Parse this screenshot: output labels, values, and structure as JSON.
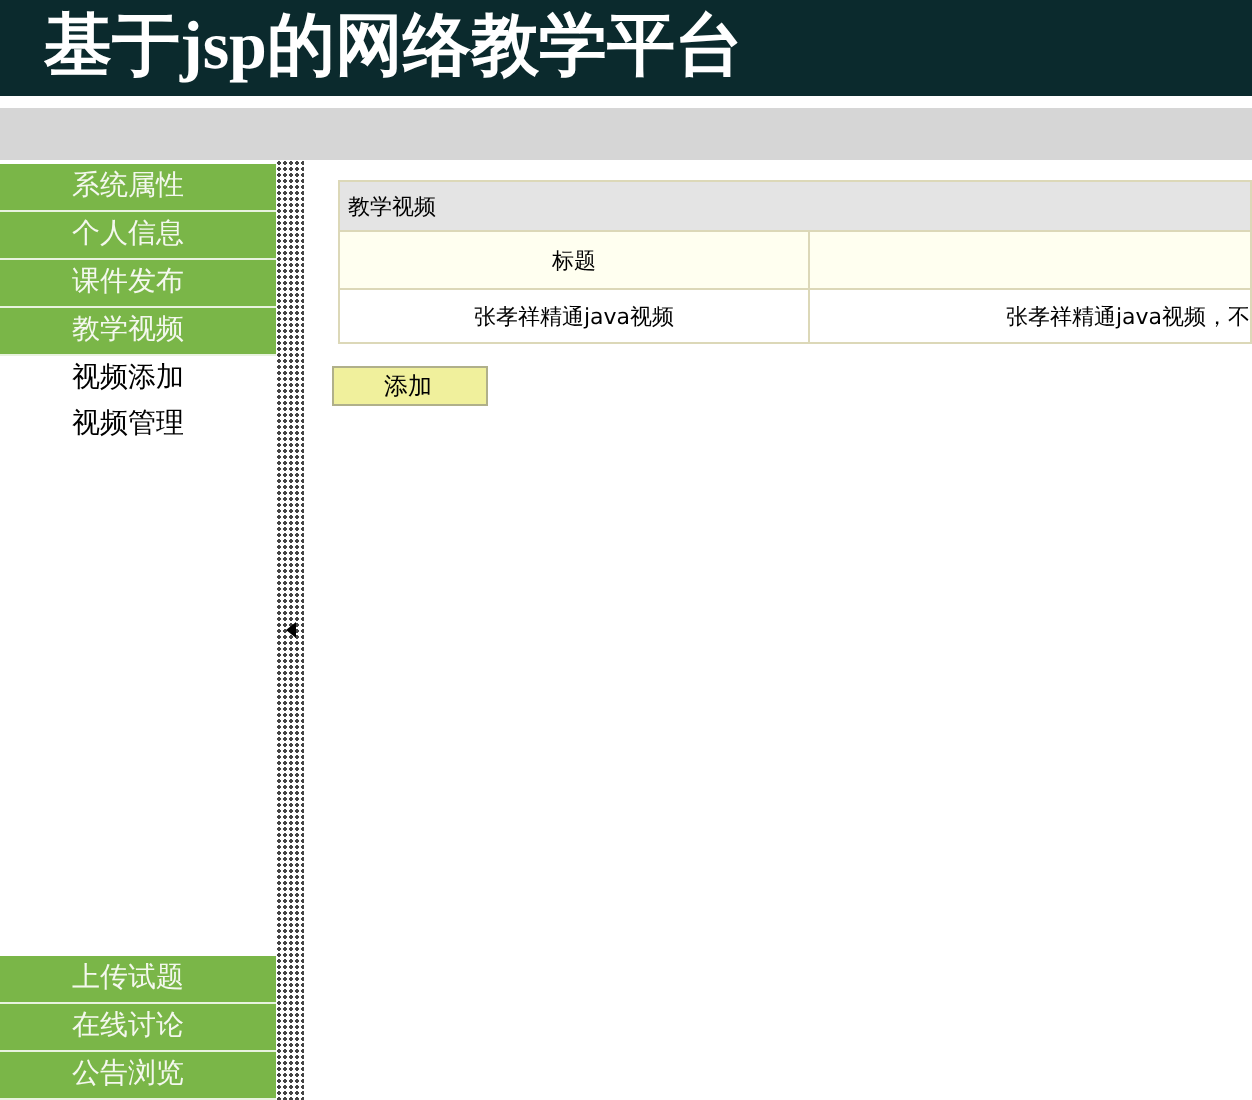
{
  "header": {
    "title": "基于jsp的网络教学平台"
  },
  "sidebar": {
    "items": [
      {
        "label": "系统属性",
        "kind": "group"
      },
      {
        "label": "个人信息",
        "kind": "group"
      },
      {
        "label": "课件发布",
        "kind": "group"
      },
      {
        "label": "教学视频",
        "kind": "group"
      },
      {
        "label": "视频添加",
        "kind": "sub"
      },
      {
        "label": "视频管理",
        "kind": "sub"
      }
    ],
    "bottom_items": [
      {
        "label": "上传试题",
        "kind": "group"
      },
      {
        "label": "在线讨论",
        "kind": "group"
      },
      {
        "label": "公告浏览",
        "kind": "group"
      }
    ]
  },
  "panel": {
    "title": "教学视频",
    "columns": [
      "标题"
    ],
    "rows": [
      [
        "张孝祥精通java视频",
        "张孝祥精通java视频，不"
      ]
    ]
  },
  "buttons": [
    "添加"
  ]
}
